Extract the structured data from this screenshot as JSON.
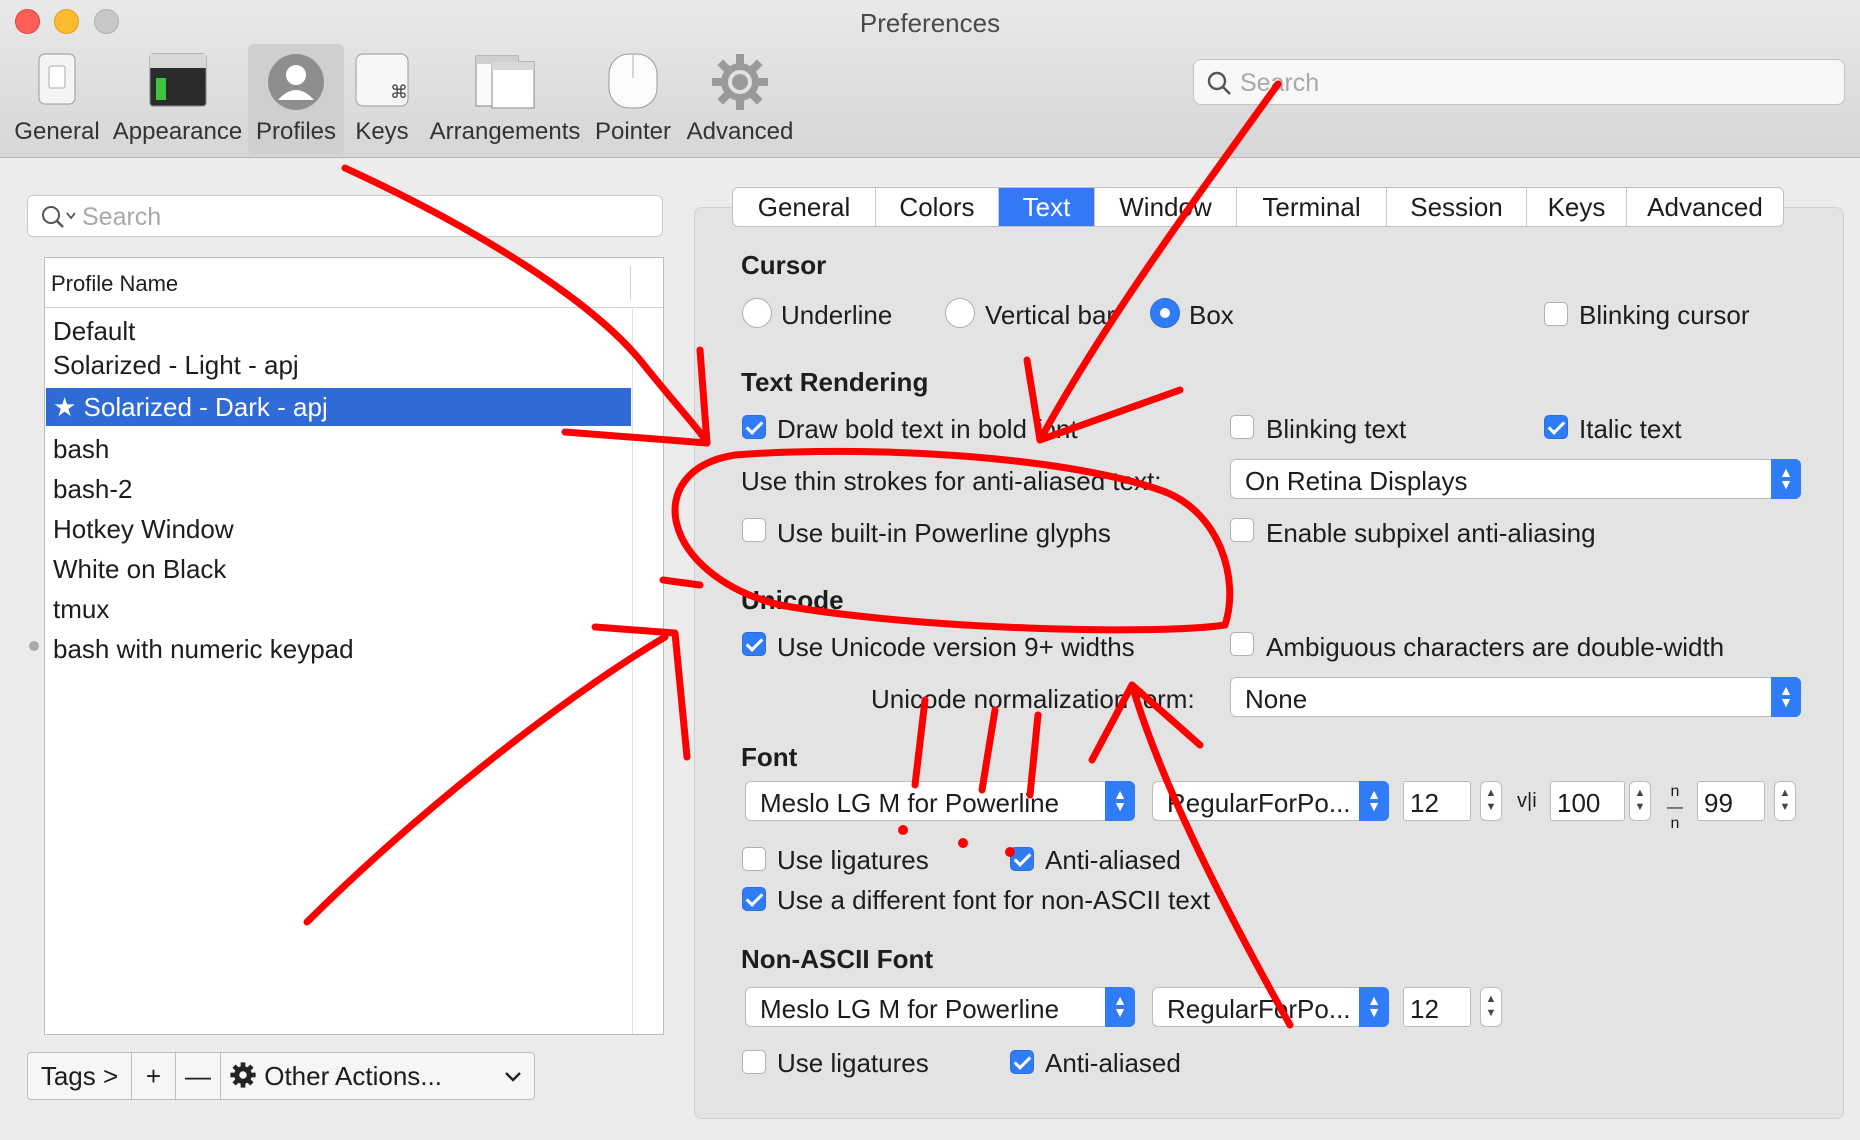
{
  "window": {
    "title": "Preferences"
  },
  "toolbar": {
    "items": [
      {
        "label": "General",
        "icon": "switch-icon"
      },
      {
        "label": "Appearance",
        "icon": "window-icon"
      },
      {
        "label": "Profiles",
        "icon": "user-icon",
        "selected": true
      },
      {
        "label": "Keys",
        "icon": "command-key-icon"
      },
      {
        "label": "Arrangements",
        "icon": "arrangements-icon"
      },
      {
        "label": "Pointer",
        "icon": "mouse-icon"
      },
      {
        "label": "Advanced",
        "icon": "gear-icon"
      }
    ],
    "search_placeholder": "Search"
  },
  "sidebar": {
    "search_placeholder": "Search",
    "column_header": "Profile Name",
    "profiles": [
      "Default",
      "Solarized - Light - apj",
      "★ Solarized - Dark - apj",
      "bash",
      "bash-2",
      "Hotkey Window",
      "White on Black",
      "tmux",
      "bash with numeric keypad"
    ],
    "selected_index": 2,
    "bottom": {
      "tags": "Tags >",
      "add": "+",
      "remove": "—",
      "other_actions": "Other Actions..."
    }
  },
  "tabs": {
    "items": [
      "General",
      "Colors",
      "Text",
      "Window",
      "Terminal",
      "Session",
      "Keys",
      "Advanced"
    ],
    "active_index": 2
  },
  "cursor": {
    "heading": "Cursor",
    "options": [
      "Underline",
      "Vertical bar",
      "Box"
    ],
    "selected": "Box",
    "blinking_label": "Blinking cursor",
    "blinking": false
  },
  "text_rendering": {
    "heading": "Text Rendering",
    "draw_bold": {
      "label": "Draw bold text in bold font",
      "checked": true
    },
    "blinking_text": {
      "label": "Blinking text",
      "checked": false
    },
    "italic_text": {
      "label": "Italic text",
      "checked": true
    },
    "thin_strokes_label": "Use thin strokes for anti-aliased text:",
    "thin_strokes_value": "On Retina Displays",
    "powerline": {
      "label": "Use built-in Powerline glyphs",
      "checked": false
    },
    "subpixel": {
      "label": "Enable subpixel anti-aliasing",
      "checked": false
    }
  },
  "unicode": {
    "heading": "Unicode",
    "widths": {
      "label": "Use Unicode version 9+ widths",
      "checked": true
    },
    "ambiguous": {
      "label": "Ambiguous characters are double-width",
      "checked": false
    },
    "normalization_label": "Unicode normalization form:",
    "normalization_value": "None"
  },
  "font": {
    "heading": "Font",
    "family": "Meslo LG M for Powerline",
    "style": "RegularForPo...",
    "size": "12",
    "v_spacing_icon": "v|i",
    "v_spacing": "100",
    "h_spacing_icon": "n/n",
    "h_spacing": "99",
    "ligatures": {
      "label": "Use ligatures",
      "checked": false
    },
    "anti_aliased": {
      "label": "Anti-aliased",
      "checked": true
    },
    "different_font": {
      "label": "Use a different font for non-ASCII text",
      "checked": true
    }
  },
  "non_ascii_font": {
    "heading": "Non-ASCII Font",
    "family": "Meslo LG M for Powerline",
    "style": "RegularForPo...",
    "size": "12",
    "ligatures": {
      "label": "Use ligatures",
      "checked": false
    },
    "anti_aliased": {
      "label": "Anti-aliased",
      "checked": true
    }
  },
  "colors": {
    "accent": "#2f7cf6",
    "selection": "#2f6ad5",
    "annotation": "#ff0000"
  }
}
